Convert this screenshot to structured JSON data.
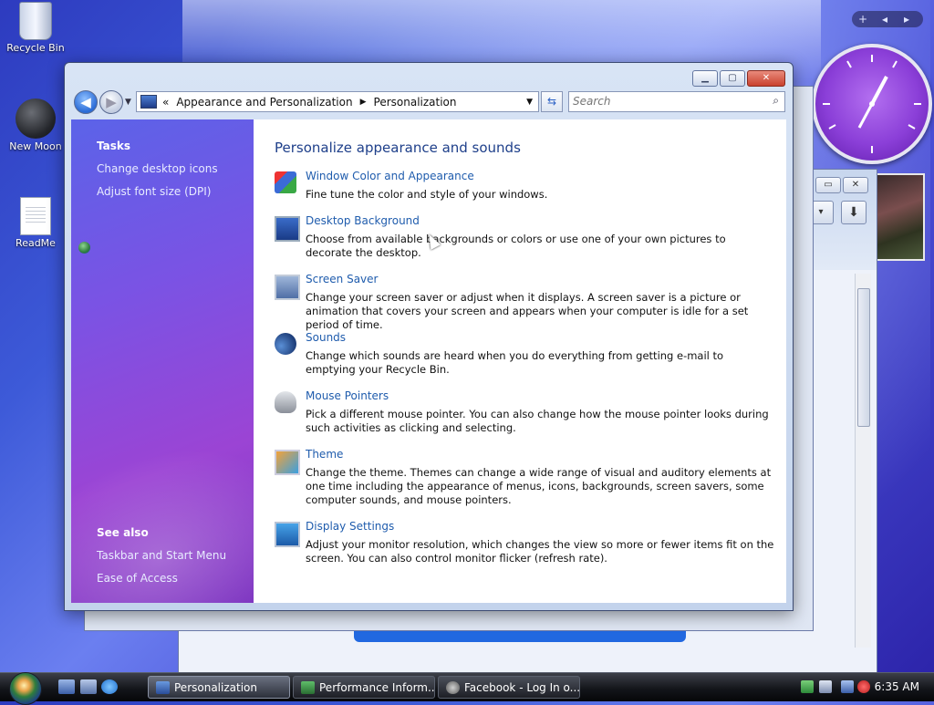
{
  "desktop": {
    "icons": [
      {
        "label": "Recycle Bin"
      },
      {
        "label": "New Moon"
      },
      {
        "label": "ReadMe"
      }
    ]
  },
  "window": {
    "breadcrumb": {
      "chevrons": "«",
      "part1": "Appearance and Personalization",
      "part2": "Personalization"
    },
    "search_placeholder": "Search",
    "sidebar": {
      "tasks_heading": "Tasks",
      "tasks": [
        "Change desktop icons",
        "Adjust font size (DPI)"
      ],
      "see_also_heading": "See also",
      "see_also": [
        "Taskbar and Start Menu",
        "Ease of Access"
      ]
    },
    "heading": "Personalize appearance and sounds",
    "items": [
      {
        "title": "Window Color and Appearance",
        "desc": "Fine tune the color and style of your windows.",
        "icon": "color-icon"
      },
      {
        "title": "Desktop Background",
        "desc": "Choose from available backgrounds or colors or use one of your own pictures to decorate the desktop.",
        "icon": "wallpaper-icon"
      },
      {
        "title": "Screen Saver",
        "desc": "Change your screen saver or adjust when it displays. A screen saver is a picture or animation that covers your screen and appears when your computer is idle for a set period of time.",
        "icon": "screensaver-icon"
      },
      {
        "title": "Sounds",
        "desc": "Change which sounds are heard when you do everything from getting e-mail to emptying your Recycle Bin.",
        "icon": "sounds-icon"
      },
      {
        "title": "Mouse Pointers",
        "desc": "Pick a different mouse pointer. You can also change how the mouse pointer looks during such activities as clicking and selecting.",
        "icon": "mouse-icon"
      },
      {
        "title": "Theme",
        "desc": "Change the theme. Themes can change a wide range of visual and auditory elements at one time including the appearance of menus, icons, backgrounds, screen savers, some computer sounds, and mouse pointers.",
        "icon": "theme-icon"
      },
      {
        "title": "Display Settings",
        "desc": "Adjust your monitor resolution, which changes the view so more or fewer items fit on the screen. You can also control monitor flicker (refresh rate).",
        "icon": "display-icon"
      }
    ]
  },
  "taskbar": {
    "tasks": [
      {
        "label": "Personalization",
        "active": true
      },
      {
        "label": "Performance Inform...",
        "active": false
      },
      {
        "label": "Facebook - Log In o...",
        "active": false
      }
    ],
    "time": "6:35 AM"
  },
  "colors": {
    "link": "#1f5cad",
    "heading": "#1e3f8a",
    "sidebar_start": "#5b63e8",
    "sidebar_end": "#9b44d4"
  }
}
